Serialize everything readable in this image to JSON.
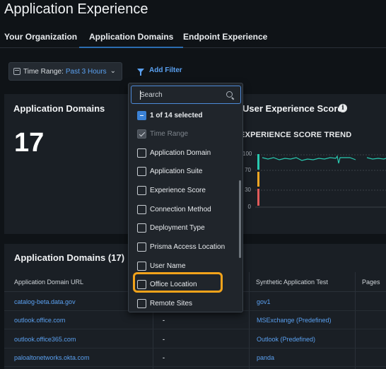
{
  "page_title": "Application Experience",
  "tabs": [
    {
      "label": "Your Organization"
    },
    {
      "label": "Application Domains"
    },
    {
      "label": "Endpoint Experience"
    }
  ],
  "toolbar": {
    "time_range_label": "Time Range:",
    "time_range_value": "Past 3 Hours",
    "add_filter_label": "Add Filter"
  },
  "app_domains_card": {
    "title": "Application Domains",
    "count": "17"
  },
  "ux_card": {
    "title": "User Experience Score",
    "trend_title": "EXPERIENCE SCORE TREND",
    "y_ticks": [
      "100",
      "70",
      "30",
      "0"
    ],
    "colors": {
      "good": "#29c9b0",
      "fair": "#f5a623",
      "poor": "#e05a5a"
    }
  },
  "filter_dropdown": {
    "search_placeholder": "Search",
    "selected_text": "1 of 14 selected",
    "items": [
      {
        "label": "Time Range",
        "state": "checked-disabled"
      },
      {
        "label": "Application Domain",
        "state": "unchecked"
      },
      {
        "label": "Application Suite",
        "state": "unchecked"
      },
      {
        "label": "Experience Score",
        "state": "unchecked"
      },
      {
        "label": "Connection Method",
        "state": "unchecked"
      },
      {
        "label": "Deployment Type",
        "state": "unchecked"
      },
      {
        "label": "Prisma Access Location",
        "state": "unchecked"
      },
      {
        "label": "User Name",
        "state": "unchecked"
      },
      {
        "label": "Office Location",
        "state": "unchecked"
      },
      {
        "label": "Remote Sites",
        "state": "unchecked"
      }
    ],
    "highlighted_item": "Office Location",
    "highlight_color": "#f2a31b"
  },
  "table": {
    "title": "Application Domains (17)",
    "headers": [
      "Application Domain URL",
      "Synthetic Application Test",
      "Pages"
    ],
    "rows": [
      {
        "url": "catalog-beta.data.gov",
        "dash": "",
        "test": "gov1"
      },
      {
        "url": "outlook.office.com",
        "dash": "-",
        "test": "MSExchange (Predefined)"
      },
      {
        "url": "outlook.office365.com",
        "dash": "-",
        "test": "Outlook (Predefined)"
      },
      {
        "url": "paloaltonetworks.okta.com",
        "dash": "-",
        "test": "panda"
      }
    ]
  }
}
